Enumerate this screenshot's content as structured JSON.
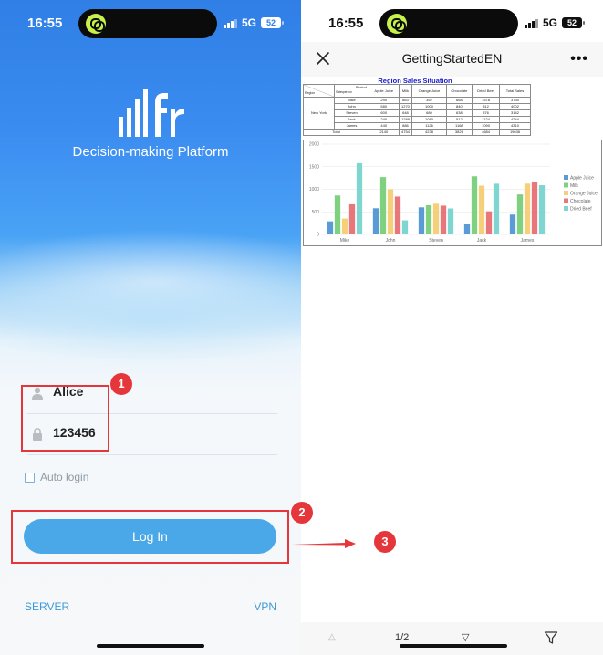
{
  "left_screen": {
    "status": {
      "time": "16:55",
      "network": "5G",
      "battery": "52"
    },
    "logo_text": "fr",
    "platform_title": "Decision-making Platform",
    "username": "Alice",
    "password": "123456",
    "auto_login_label": "Auto login",
    "login_button": "Log In",
    "server_link": "SERVER",
    "vpn_link": "VPN"
  },
  "annotations": {
    "badge_1": "1",
    "badge_2": "2",
    "badge_3": "3"
  },
  "right_screen": {
    "status": {
      "time": "16:55",
      "network": "5G",
      "battery": "52"
    },
    "nav_title": "GettingStartedEN",
    "more_label": "•••",
    "report": {
      "title": "Region Sales Situation",
      "header_product": "Product",
      "header_salesperson": "Salesperson",
      "header_region": "Region",
      "columns": [
        "Apple Juice",
        "Milk",
        "Orange Juice",
        "Chocolate",
        "Dried Beef",
        "Total Sales"
      ],
      "region": "New York",
      "rows": [
        {
          "name": "Mike",
          "values": [
            "290",
            "863",
            "352",
            "668",
            "1578",
            "3730"
          ]
        },
        {
          "name": "John",
          "values": [
            "580",
            "1270",
            "1000",
            "840",
            "312",
            "4002"
          ]
        },
        {
          "name": "Steven",
          "values": [
            "600",
            "648",
            "680",
            "638",
            "576",
            "3142"
          ]
        },
        {
          "name": "Jack",
          "values": [
            "240",
            "1288",
            "1080",
            "512",
            "1124",
            "4244"
          ]
        },
        {
          "name": "James",
          "values": [
            "440",
            "886",
            "1126",
            "1168",
            "1090",
            "4310"
          ]
        }
      ],
      "total_label": "Total",
      "totals": [
        "2140",
        "4754",
        "4238",
        "3826",
        "4684",
        "19636"
      ]
    },
    "bottom_bar": {
      "prev": "△",
      "page": "1/2",
      "next": "▽"
    }
  },
  "chart_data": {
    "type": "bar",
    "categories": [
      "Mike",
      "John",
      "Steven",
      "Jack",
      "James"
    ],
    "ylim": [
      0,
      2000
    ],
    "yticks": [
      "0",
      "500",
      "1000",
      "1500",
      "2000"
    ],
    "legend_position": "right",
    "grid": true,
    "series": [
      {
        "name": "Apple Juice",
        "color": "#5b9bd5",
        "values": [
          290,
          580,
          600,
          240,
          440
        ]
      },
      {
        "name": "Milk",
        "color": "#7fd17f",
        "values": [
          863,
          1270,
          648,
          1288,
          886
        ]
      },
      {
        "name": "Orange Juice",
        "color": "#f6cf7a",
        "values": [
          352,
          1000,
          680,
          1080,
          1126
        ]
      },
      {
        "name": "Chocolate",
        "color": "#e8767a",
        "values": [
          668,
          840,
          638,
          512,
          1168
        ]
      },
      {
        "name": "Dried Beef",
        "color": "#7fd6d0",
        "values": [
          1578,
          312,
          576,
          1124,
          1090
        ]
      }
    ]
  }
}
